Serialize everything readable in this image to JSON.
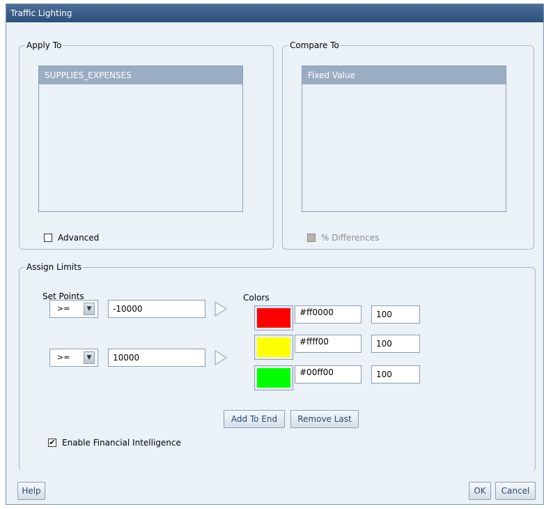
{
  "dialog": {
    "title": "Traffic Lighting"
  },
  "apply_to": {
    "legend": "Apply To",
    "items": [
      "SUPPLIES_EXPENSES"
    ],
    "advanced_label": "Advanced",
    "advanced_checked": false
  },
  "compare_to": {
    "legend": "Compare To",
    "items": [
      "Fixed Value"
    ],
    "pct_diff_label": "% Differences",
    "pct_diff_checked": false,
    "pct_diff_enabled": false
  },
  "assign_limits": {
    "legend": "Assign Limits",
    "set_points_label": "Set Points",
    "colors_label": "Colors",
    "set_points": [
      {
        "operator": ">=",
        "value": "-10000"
      },
      {
        "operator": ">=",
        "value": "10000"
      }
    ],
    "colors": [
      {
        "hex": "#ff0000",
        "value": "100"
      },
      {
        "hex": "#ffff00",
        "value": "100"
      },
      {
        "hex": "#00ff00",
        "value": "100"
      }
    ],
    "add_to_end_label": "Add To End",
    "remove_last_label": "Remove Last",
    "enable_fi_label": "Enable Financial Intelligence",
    "enable_fi_checked": true
  },
  "footer": {
    "help_label": "Help",
    "ok_label": "OK",
    "cancel_label": "Cancel"
  }
}
